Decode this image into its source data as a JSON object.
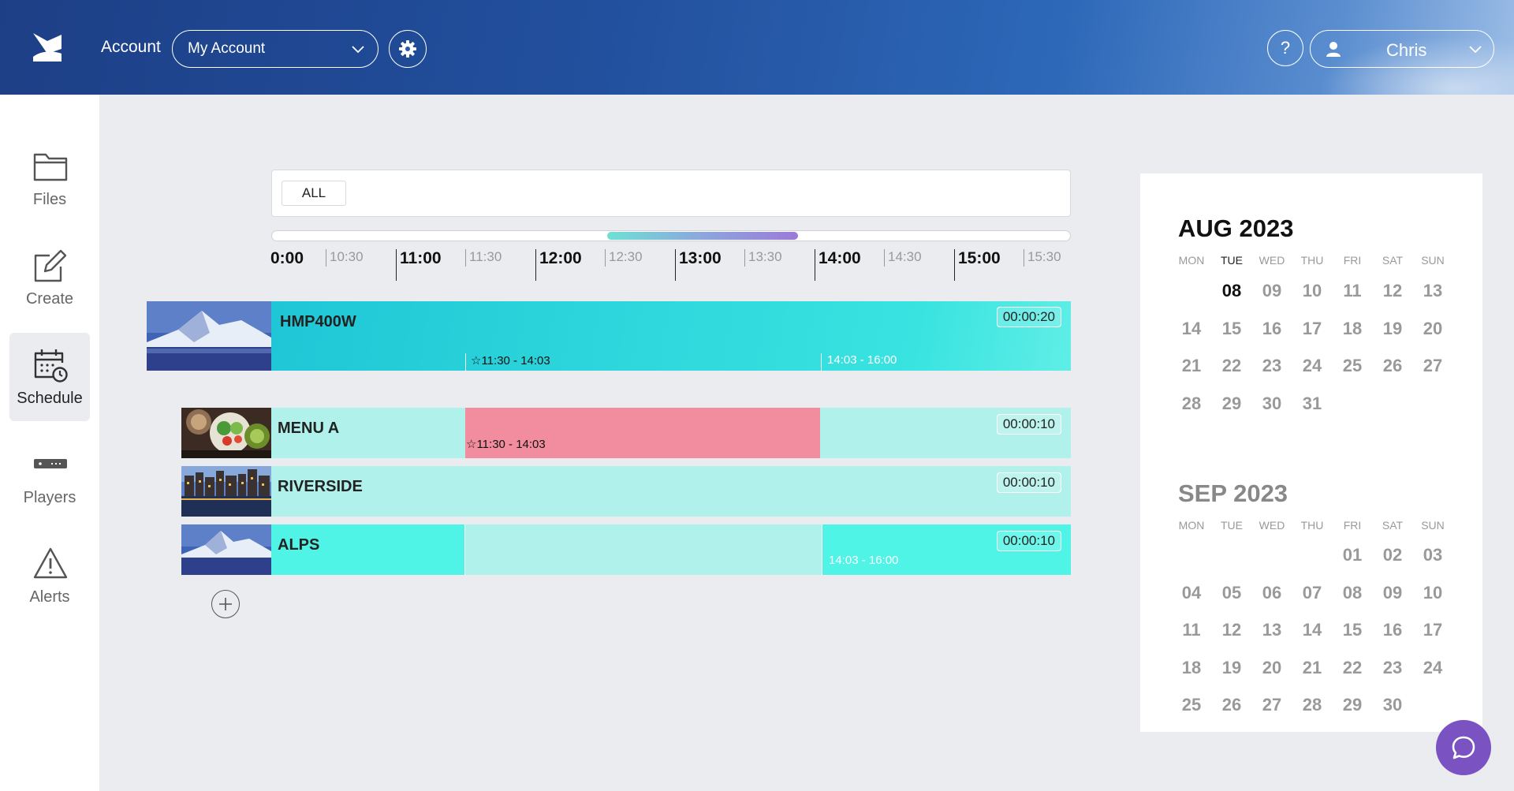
{
  "header": {
    "account_label": "Account",
    "account_select": "My Account",
    "help_label": "?",
    "user_name": "Chris"
  },
  "sidebar": {
    "items": [
      {
        "label": "Files",
        "icon": "folder-icon"
      },
      {
        "label": "Create",
        "icon": "edit-icon"
      },
      {
        "label": "Schedule",
        "icon": "calendar-clock-icon",
        "active": true
      },
      {
        "label": "Players",
        "icon": "player-device-icon"
      },
      {
        "label": "Alerts",
        "icon": "warning-icon"
      }
    ]
  },
  "filter": {
    "chip_label": "ALL"
  },
  "timeline": {
    "ticks": [
      "0:00",
      "10:30",
      "11:00",
      "11:30",
      "12:00",
      "12:30",
      "13:00",
      "13:30",
      "14:00",
      "14:30",
      "15:00",
      "15:30"
    ],
    "scroll": {
      "visible_start_fraction": 0.42,
      "visible_end_fraction": 0.66
    }
  },
  "player": {
    "name": "HMP400W",
    "duration": "00:00:20",
    "seg1_label": "11:30 - 14:03",
    "seg2_label": "14:03 - 16:00"
  },
  "playlists": [
    {
      "name": "MENU A",
      "duration": "00:00:10",
      "seg_label": "11:30 - 14:03"
    },
    {
      "name": "RIVERSIDE",
      "duration": "00:00:10"
    },
    {
      "name": "ALPS",
      "duration": "00:00:10",
      "seg_label": "14:03 - 16:00"
    }
  ],
  "calendar": {
    "dow": [
      "MON",
      "TUE",
      "WED",
      "THU",
      "FRI",
      "SAT",
      "SUN"
    ],
    "months": [
      {
        "title": "AUG 2023",
        "weeks": [
          [
            "",
            "08",
            "09",
            "10",
            "11",
            "12",
            "13"
          ],
          [
            "14",
            "15",
            "16",
            "17",
            "18",
            "19",
            "20"
          ],
          [
            "21",
            "22",
            "23",
            "24",
            "25",
            "26",
            "27"
          ],
          [
            "28",
            "29",
            "30",
            "31",
            "",
            "",
            ""
          ]
        ]
      },
      {
        "title": "SEP 2023",
        "weeks": [
          [
            "",
            "",
            "",
            "",
            "01",
            "02",
            "03"
          ],
          [
            "04",
            "05",
            "06",
            "07",
            "08",
            "09",
            "10"
          ],
          [
            "11",
            "12",
            "13",
            "14",
            "15",
            "16",
            "17"
          ],
          [
            "18",
            "19",
            "20",
            "21",
            "22",
            "23",
            "24"
          ],
          [
            "25",
            "26",
            "27",
            "28",
            "29",
            "30",
            ""
          ]
        ]
      }
    ]
  },
  "colors": {
    "accent_teal": "#3ee0db",
    "light_teal": "#b0f1eb",
    "bright_teal": "#4ff4e6",
    "pink": "#f28d9f",
    "chat_purple": "#7a52c2"
  }
}
